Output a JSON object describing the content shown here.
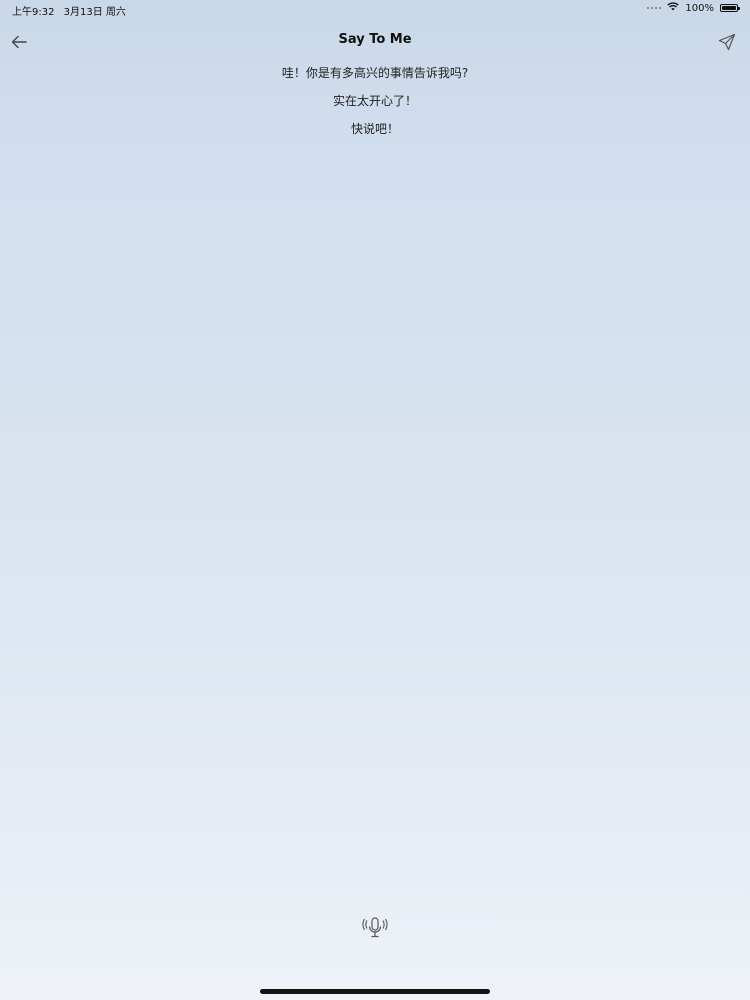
{
  "status_bar": {
    "time": "上午9:32",
    "date": "3月13日 周六",
    "battery_percent_label": "100%",
    "battery_level": 1.0,
    "icons": [
      "signal-dots-icon",
      "wifi-icon",
      "battery-icon"
    ]
  },
  "nav": {
    "title": "Say To Me",
    "back_icon": "arrow-left-icon",
    "send_icon": "paper-plane-icon"
  },
  "messages": [
    "哇！你是有多高兴的事情告诉我吗?",
    "实在太开心了！",
    "快说吧！"
  ],
  "mic": {
    "icon": "microphone-icon"
  },
  "colors": {
    "background_top": "#c9d8e8",
    "background_bottom": "#eef2f8",
    "text": "#1c1c1e"
  }
}
